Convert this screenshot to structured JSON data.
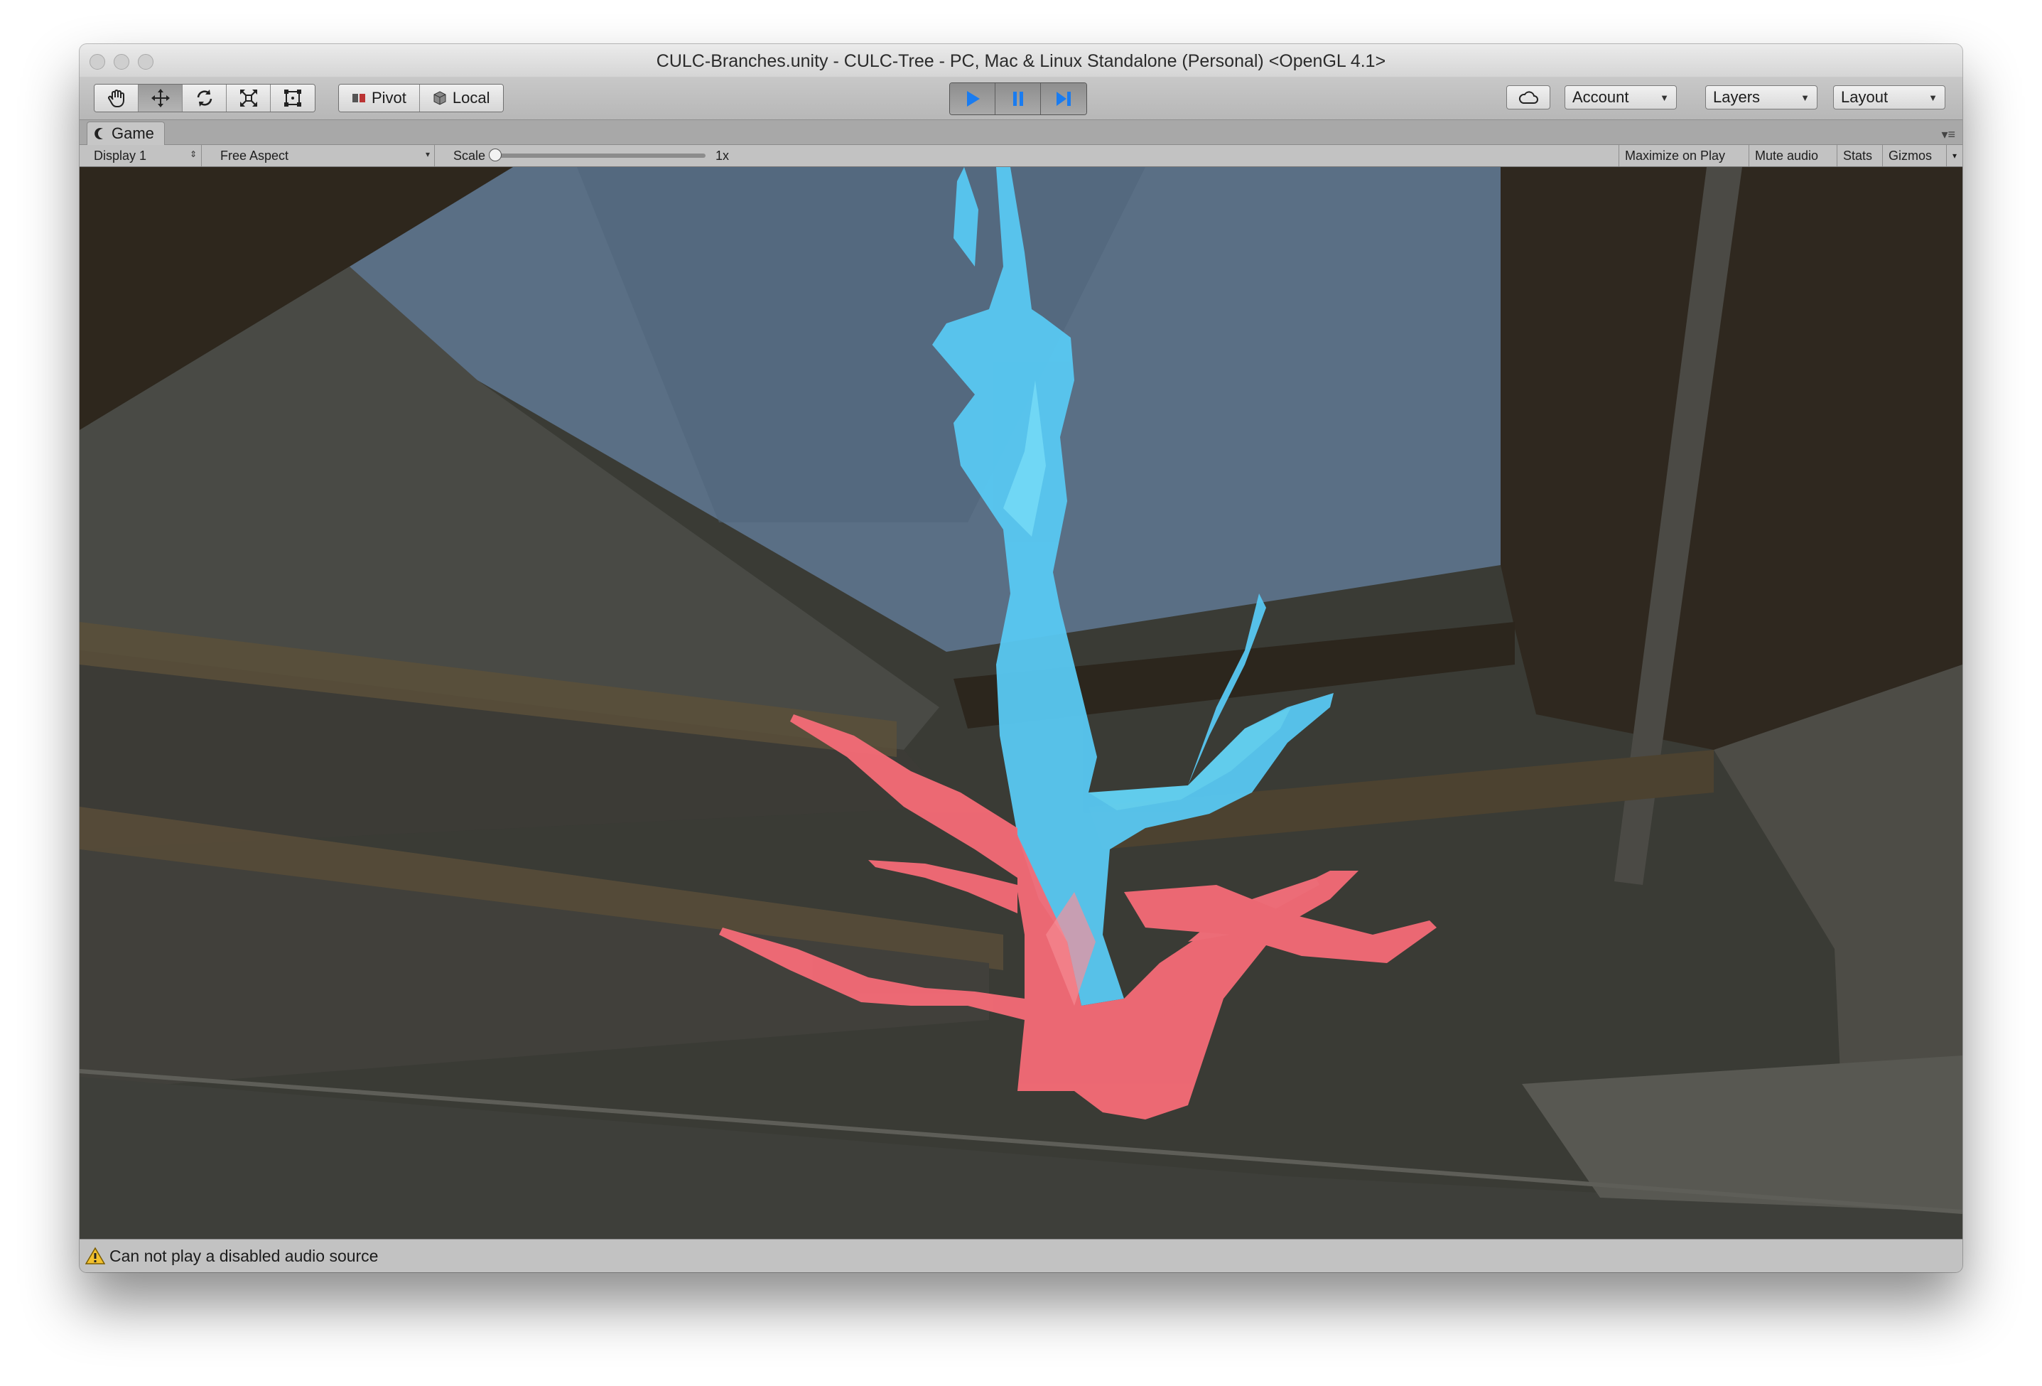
{
  "window": {
    "title": "CULC-Branches.unity - CULC-Tree - PC, Mac & Linux Standalone (Personal) <OpenGL 4.1>"
  },
  "toolbar": {
    "tools": [
      "hand-icon",
      "move-icon",
      "rotate-icon",
      "scale-icon",
      "rect-icon"
    ],
    "pivot_label": "Pivot",
    "local_label": "Local",
    "play_controls": [
      "play-icon",
      "pause-icon",
      "step-icon"
    ],
    "account_label": "Account",
    "layers_label": "Layers",
    "layout_label": "Layout"
  },
  "game_tab": {
    "label": "Game",
    "display_label": "Display 1",
    "aspect_label": "Free Aspect",
    "scale_label": "Scale",
    "scale_value": "1x",
    "scale_fraction": 0,
    "maximize_label": "Maximize on Play",
    "mute_label": "Mute audio",
    "stats_label": "Stats",
    "gizmos_label": "Gizmos"
  },
  "status": {
    "message": "Can not play a disabled audio source"
  },
  "colors": {
    "accent_play": "#1a7cf0",
    "tree_upper": "#58c8f2",
    "tree_lower": "#f56b77",
    "sky": "#566b80"
  }
}
